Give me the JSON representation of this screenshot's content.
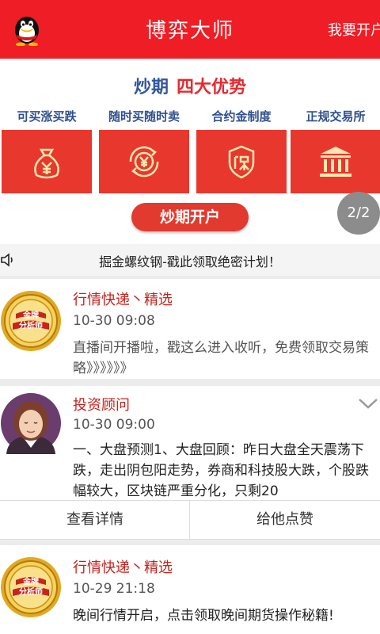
{
  "header": {
    "title": "博弈大师",
    "open_account": "我要开户",
    "logo_icon": "qq-penguin-icon"
  },
  "banner": {
    "title_part1": "炒期",
    "title_part2": "四大优势",
    "features": [
      {
        "label": "可买涨买跌",
        "icon": "money-bag-icon"
      },
      {
        "label": "随时买随时卖",
        "icon": "yen-cycle-icon"
      },
      {
        "label": "合约金制度",
        "icon": "shield-guarantee-icon"
      },
      {
        "label": "正规交易所",
        "icon": "exchange-building-icon"
      }
    ],
    "button": "炒期开户",
    "pager": "2/2"
  },
  "notice": {
    "icon": "speaker-icon",
    "text": "掘金螺纹钢-戳此领取绝密计划！"
  },
  "feed": [
    {
      "avatar": "gold-analyst-badge",
      "avatar_text": [
        "金牌",
        "分析师"
      ],
      "name": "行情快递丶精选",
      "time": "10-30 09:08",
      "content": "直播间开播啦，戳这么进入收听，免费领取交易策略》》》》》》"
    },
    {
      "avatar": "advisor-portrait",
      "name": "投资顾问",
      "time": "10-30 09:00",
      "content": "一、大盘预测1、大盘回顾：昨日大盘全天震荡下跌，走出阴包阳走势，券商和科技股大跌，个股跌幅较大，区块链严重分化，只剩20",
      "actions": {
        "details": "查看详情",
        "like": "给他点赞"
      }
    },
    {
      "avatar": "gold-analyst-badge",
      "avatar_text": [
        "金牌",
        "分析师"
      ],
      "name": "行情快递丶精选",
      "time": "10-29 21:18",
      "content": "晚间行情开启，点击领取晚间期货操作秘籍!"
    }
  ]
}
